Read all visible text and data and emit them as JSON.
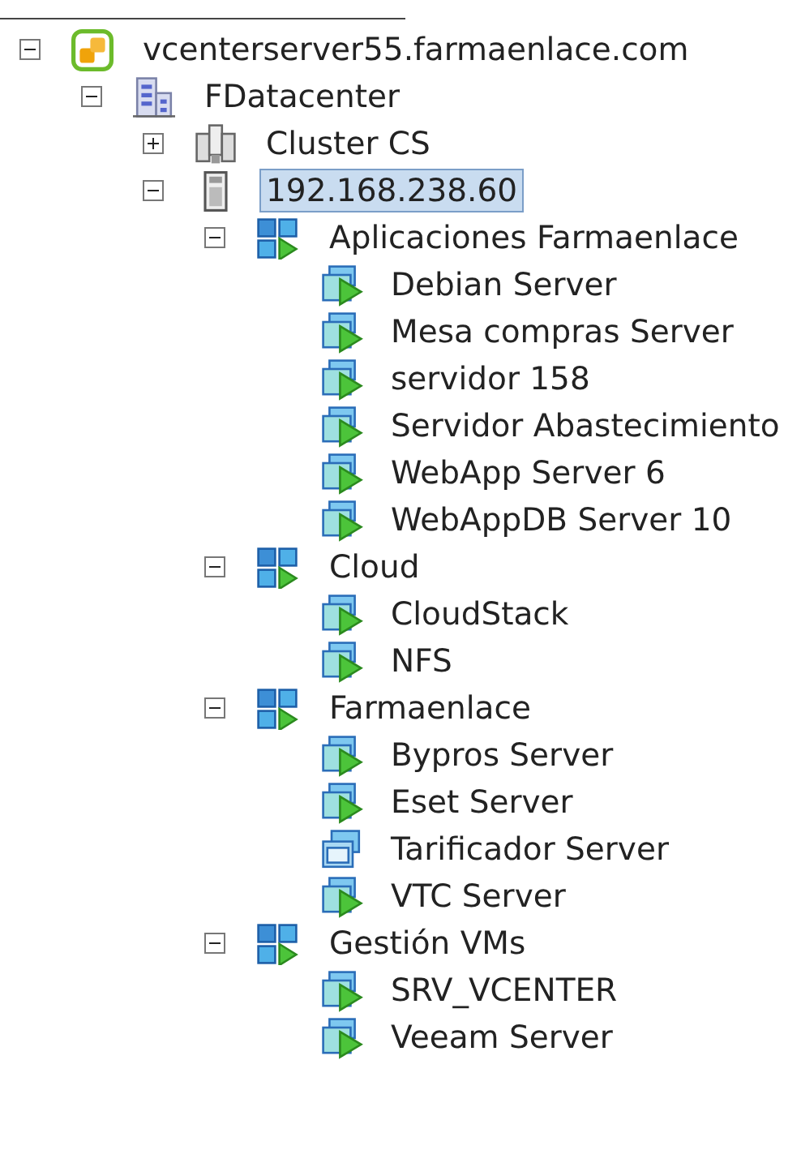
{
  "tree": [
    {
      "kind": "vcenter",
      "label": "vcenterserver55.farmaenlace.com",
      "expanded": true,
      "selected": false,
      "children": [
        {
          "kind": "datacenter",
          "label": "FDatacenter",
          "expanded": true,
          "selected": false,
          "children": [
            {
              "kind": "cluster",
              "label": "Cluster CS",
              "expanded": false,
              "selected": false
            },
            {
              "kind": "host",
              "label": "192.168.238.60",
              "expanded": true,
              "selected": true,
              "children": [
                {
                  "kind": "vapp",
                  "label": "Aplicaciones Farmaenlace",
                  "expanded": true,
                  "selected": false,
                  "children": [
                    {
                      "kind": "vm",
                      "label": "Debian Server",
                      "powered_on": true,
                      "selected": false
                    },
                    {
                      "kind": "vm",
                      "label": "Mesa compras Server",
                      "powered_on": true,
                      "selected": false
                    },
                    {
                      "kind": "vm",
                      "label": "servidor 158",
                      "powered_on": true,
                      "selected": false
                    },
                    {
                      "kind": "vm",
                      "label": "Servidor Abastecimiento",
                      "powered_on": true,
                      "selected": false
                    },
                    {
                      "kind": "vm",
                      "label": "WebApp Server 6",
                      "powered_on": true,
                      "selected": false
                    },
                    {
                      "kind": "vm",
                      "label": "WebAppDB Server 10",
                      "powered_on": true,
                      "selected": false
                    }
                  ]
                },
                {
                  "kind": "vapp",
                  "label": "Cloud",
                  "expanded": true,
                  "selected": false,
                  "children": [
                    {
                      "kind": "vm",
                      "label": "CloudStack",
                      "powered_on": true,
                      "selected": false
                    },
                    {
                      "kind": "vm",
                      "label": "NFS",
                      "powered_on": true,
                      "selected": false
                    }
                  ]
                },
                {
                  "kind": "vapp",
                  "label": "Farmaenlace",
                  "expanded": true,
                  "selected": false,
                  "children": [
                    {
                      "kind": "vm",
                      "label": "Bypros Server",
                      "powered_on": true,
                      "selected": false
                    },
                    {
                      "kind": "vm",
                      "label": "Eset Server",
                      "powered_on": true,
                      "selected": false
                    },
                    {
                      "kind": "vm",
                      "label": "Tarificador Server",
                      "powered_on": false,
                      "selected": false
                    },
                    {
                      "kind": "vm",
                      "label": "VTC Server",
                      "powered_on": true,
                      "selected": false
                    }
                  ]
                },
                {
                  "kind": "vapp",
                  "label": "Gestión VMs",
                  "expanded": true,
                  "selected": false,
                  "children": [
                    {
                      "kind": "vm",
                      "label": "SRV_VCENTER",
                      "powered_on": true,
                      "selected": false
                    },
                    {
                      "kind": "vm",
                      "label": "Veeam Server",
                      "powered_on": true,
                      "selected": false
                    }
                  ]
                }
              ]
            }
          ]
        }
      ]
    }
  ]
}
